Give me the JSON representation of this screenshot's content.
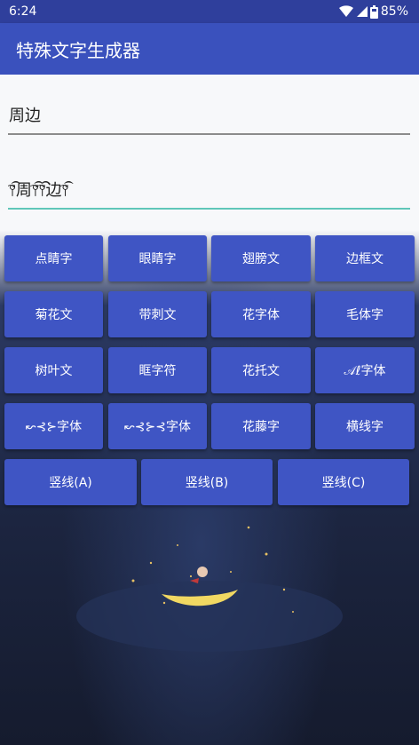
{
  "status": {
    "time": "6:24",
    "battery": "85%",
    "icons": [
      "wifi-icon",
      "cell-signal-icon",
      "battery-icon"
    ]
  },
  "app": {
    "title": "特殊文字生成器"
  },
  "input": {
    "value": "周边"
  },
  "output": {
    "value": "⫯⃕͡周⫯⃕͡⫯⃕͡边⫯⃕͡"
  },
  "buttons": {
    "row1": [
      "点睛字",
      "眼睛字",
      "翅膀文",
      "边框文"
    ],
    "row2": [
      "菊花文",
      "带刺文",
      "花字体",
      "毛体字"
    ],
    "row3": [
      "树叶文",
      "眶字符",
      "花托文",
      "𝒜ℓ字体"
    ],
    "row4": [
      "↜⊰⊱字体",
      "↜⊰⊱⊰字体",
      "花藤字",
      "横线字"
    ],
    "row5": [
      "竖线(A)",
      "竖线(B)",
      "竖线(C)"
    ]
  },
  "colors": {
    "statusbar": "#2f3f9c",
    "appbar": "#3a51bd",
    "button": "#3f55c4",
    "field_active_underline": "#5fc6b8"
  }
}
